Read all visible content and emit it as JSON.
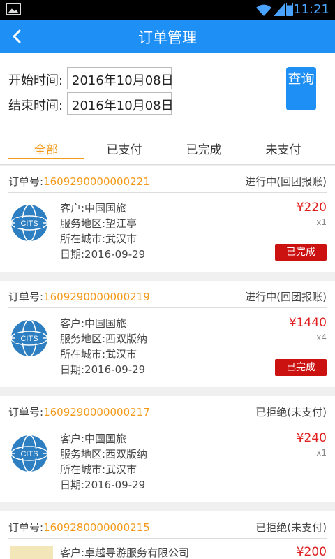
{
  "status_bar": {
    "time": "11:21"
  },
  "header": {
    "title": "订单管理"
  },
  "filter": {
    "start_label": "开始时间:",
    "start_value": "2016年10月08日",
    "end_label": "结束时间:",
    "end_value": "2016年10月08日",
    "query_button": "查询"
  },
  "tabs": [
    {
      "label": "全部",
      "active": true
    },
    {
      "label": "已支付",
      "active": false
    },
    {
      "label": "已完成",
      "active": false
    },
    {
      "label": "未支付",
      "active": false
    }
  ],
  "order_no_prefix": "订单号:",
  "orders": [
    {
      "order_no": "1609290000000221",
      "status": "进行中(回团报账)",
      "customer": "客户:中国国旅",
      "region": "服务地区:望江亭",
      "city": "所在城市:武汉市",
      "date": "日期:2016-09-29",
      "price": "¥220",
      "qty": "x1",
      "action": "已完成"
    },
    {
      "order_no": "1609290000000219",
      "status": "进行中(回团报账)",
      "customer": "客户:中国国旅",
      "region": "服务地区:西双版纳",
      "city": "所在城市:武汉市",
      "date": "日期:2016-09-29",
      "price": "¥1440",
      "qty": "x4",
      "action": "已完成"
    },
    {
      "order_no": "1609290000000217",
      "status": "已拒绝(未支付)",
      "customer": "客户:中国国旅",
      "region": "服务地区:西双版纳",
      "city": "所在城市:武汉市",
      "date": "日期:2016-09-29",
      "price": "¥240",
      "qty": "x1"
    },
    {
      "order_no": "1609280000000215",
      "status": "已拒绝(未支付)",
      "customer": "客户:卓越导游服务有限公司",
      "price": "¥200"
    }
  ],
  "logo_text": "CITS",
  "colors": {
    "primary": "#1e8ff5",
    "accent": "#f39a1b",
    "price": "#e02020",
    "done": "#cc1111"
  }
}
